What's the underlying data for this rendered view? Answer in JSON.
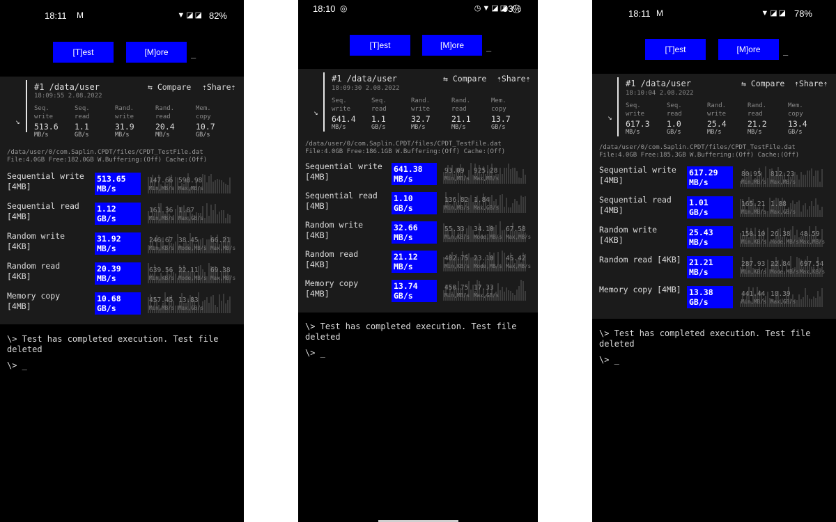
{
  "common": {
    "test_button": "[T]est",
    "more_button": "[M]ore",
    "cursor": "_",
    "compare_label": "⇆ Compare",
    "share_label": "⇡Share⇡",
    "arrow": "↘",
    "metric_labels": [
      "Seq.\nwrite",
      "Seq.\nread",
      "Rand.\nwrite",
      "Rand.\nread",
      "Mem.\ncopy"
    ],
    "log_message": "\\> Test has completed execution. Test file deleted",
    "prompt": "\\> _"
  },
  "screens": [
    {
      "status": {
        "time": "18:11",
        "app_icon": "gmail-icon",
        "battery": "82%"
      },
      "result": {
        "title": "#1 /data/user",
        "date": "18:09:55 2.08.2022",
        "metrics": [
          {
            "value": "513.6",
            "unit": "MB/s"
          },
          {
            "value": "1.1",
            "unit": "GB/s"
          },
          {
            "value": "31.9",
            "unit": "MB/s"
          },
          {
            "value": "20.4",
            "unit": "MB/s"
          },
          {
            "value": "10.7",
            "unit": "GB/s"
          }
        ],
        "path": "/data/user/0/com.Saplin.CPDT/files/CPDT_TestFile.dat",
        "file_info": "File:4.0GB Free:182.0GB W.Buffering:(Off) Cache:(Off)"
      },
      "tests": [
        {
          "name": "Sequential write\n[4MB]",
          "value": "513.65",
          "unit": "MB/s",
          "stats": [
            {
              "v": "147.66",
              "l": "Min,MB/s"
            },
            {
              "v": "598.98",
              "l": "Max,MB/s"
            }
          ]
        },
        {
          "name": "Sequential read\n[4MB]",
          "value": "1.12",
          "unit": "GB/s",
          "stats": [
            {
              "v": "161.36",
              "l": "Min,MB/s"
            },
            {
              "v": "1.87",
              "l": "Max,GB/s"
            }
          ]
        },
        {
          "name": "Random write\n[4KB]",
          "value": "31.92",
          "unit": "MB/s",
          "stats": [
            {
              "v": "246.67",
              "l": "Min,KB/s"
            },
            {
              "v": "38.45",
              "l": "Mode,MB/s"
            },
            {
              "v": "66.21",
              "l": "Max,MB/s"
            }
          ]
        },
        {
          "name": "Random read\n[4KB]",
          "value": "20.39",
          "unit": "MB/s",
          "stats": [
            {
              "v": "639.56",
              "l": "Min,KB/s"
            },
            {
              "v": "22.11",
              "l": "Mode,MB/s"
            },
            {
              "v": "69.38",
              "l": "Max,MB/s"
            }
          ]
        },
        {
          "name": "Memory copy\n[4MB]",
          "value": "10.68",
          "unit": "GB/s",
          "stats": [
            {
              "v": "457.45",
              "l": "Min,MB/s"
            },
            {
              "v": "13.83",
              "l": "Max,GB/s"
            }
          ]
        }
      ]
    },
    {
      "status": {
        "time": "18:10",
        "app_icon": "whatsapp-icon",
        "battery": "93%"
      },
      "result": {
        "title": "#1 /data/user",
        "date": "18:09:30 2.08.2022",
        "metrics": [
          {
            "value": "641.4",
            "unit": "MB/s"
          },
          {
            "value": "1.1",
            "unit": "GB/s"
          },
          {
            "value": "32.7",
            "unit": "MB/s"
          },
          {
            "value": "21.1",
            "unit": "MB/s"
          },
          {
            "value": "13.7",
            "unit": "GB/s"
          }
        ],
        "path": "/data/user/0/com.Saplin.CPDT/files/CPDT_TestFile.dat",
        "file_info": "File:4.0GB Free:186.1GB W.Buffering:(Off) Cache:(Off)"
      },
      "tests": [
        {
          "name": "Sequential write\n[4MB]",
          "value": "641.38",
          "unit": "MB/s",
          "stats": [
            {
              "v": "93.09",
              "l": "Min,MB/s"
            },
            {
              "v": "925.28",
              "l": "Max,MB/s"
            }
          ]
        },
        {
          "name": "Sequential read\n[4MB]",
          "value": "1.10",
          "unit": "GB/s",
          "stats": [
            {
              "v": "136.82",
              "l": "Min,MB/s"
            },
            {
              "v": "1.84",
              "l": "Max,GB/s"
            }
          ]
        },
        {
          "name": "Random write\n[4KB]",
          "value": "32.66",
          "unit": "MB/s",
          "stats": [
            {
              "v": "55.33",
              "l": "Min,KB/s"
            },
            {
              "v": "34.10",
              "l": "Mode,MB/s"
            },
            {
              "v": "67.58",
              "l": "Max,MB/s"
            }
          ]
        },
        {
          "name": "Random read\n[4KB]",
          "value": "21.12",
          "unit": "MB/s",
          "stats": [
            {
              "v": "402.75",
              "l": "Min,KB/s"
            },
            {
              "v": "23.10",
              "l": "Mode,MB/s"
            },
            {
              "v": "45.42",
              "l": "Max,MB/s"
            }
          ]
        },
        {
          "name": "Memory copy\n[4MB]",
          "value": "13.74",
          "unit": "GB/s",
          "stats": [
            {
              "v": "450.75",
              "l": "Min,MB/s"
            },
            {
              "v": "17.33",
              "l": "Max,GB/s"
            }
          ]
        }
      ]
    },
    {
      "status": {
        "time": "18:11",
        "app_icon": "gmail-icon",
        "battery": "78%"
      },
      "result": {
        "title": "#1 /data/user",
        "date": "18:10:04 2.08.2022",
        "metrics": [
          {
            "value": "617.3",
            "unit": "MB/s"
          },
          {
            "value": "1.0",
            "unit": "GB/s"
          },
          {
            "value": "25.4",
            "unit": "MB/s"
          },
          {
            "value": "21.2",
            "unit": "MB/s"
          },
          {
            "value": "13.4",
            "unit": "GB/s"
          }
        ],
        "path": "/data/user/0/com.Saplin.CPDT/files/CPDT_TestFile.dat",
        "file_info": "File:4.0GB Free:185.3GB W.Buffering:(Off) Cache:(Off)"
      },
      "tests": [
        {
          "name": "Sequential write\n[4MB]",
          "value": "617.29",
          "unit": "MB/s",
          "stats": [
            {
              "v": "80.95",
              "l": "Min,MB/s"
            },
            {
              "v": "812.23",
              "l": "Max,MB/s"
            }
          ]
        },
        {
          "name": "Sequential read\n[4MB]",
          "value": "1.01",
          "unit": "GB/s",
          "stats": [
            {
              "v": "165.21",
              "l": "Min,MB/s"
            },
            {
              "v": "1.88",
              "l": "Max,GB/s"
            }
          ]
        },
        {
          "name": "Random write\n[4KB]",
          "value": "25.43",
          "unit": "MB/s",
          "stats": [
            {
              "v": "150.10",
              "l": "Min,KB/s"
            },
            {
              "v": "26.38",
              "l": "Mode,MB/s"
            },
            {
              "v": "48.59",
              "l": "Max,MB/s"
            }
          ]
        },
        {
          "name": "Random read [4KB]",
          "value": "21.21",
          "unit": "MB/s",
          "stats": [
            {
              "v": "287.93",
              "l": "Min,KB/s"
            },
            {
              "v": "22.84",
              "l": "Mode,MB/s"
            },
            {
              "v": "697.54",
              "l": "Max,KB/s"
            }
          ]
        },
        {
          "name": "Memory copy [4MB]",
          "value": "13.38",
          "unit": "GB/s",
          "stats": [
            {
              "v": "441.44",
              "l": "Min,MB/s"
            },
            {
              "v": "18.39",
              "l": "Max,GB/s"
            }
          ]
        }
      ]
    }
  ]
}
